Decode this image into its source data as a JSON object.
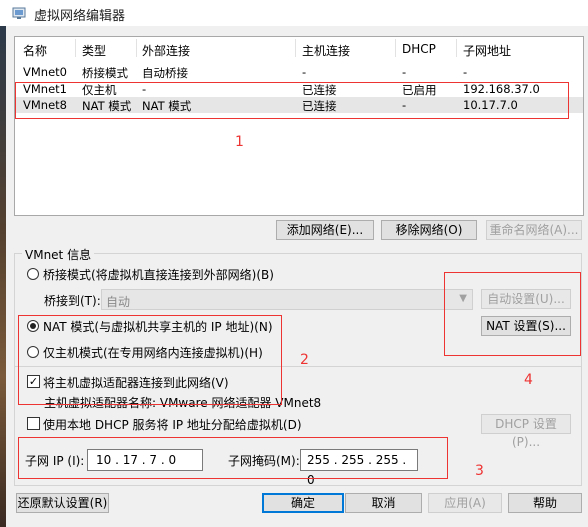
{
  "window": {
    "title": "虚拟网络编辑器"
  },
  "table": {
    "headers": [
      "名称",
      "类型",
      "外部连接",
      "主机连接",
      "DHCP",
      "子网地址"
    ],
    "rows": [
      {
        "name": "VMnet0",
        "type": "桥接模式",
        "external": "自动桥接",
        "host": "-",
        "dhcp": "-",
        "subnet": "-"
      },
      {
        "name": "VMnet1",
        "type": "仅主机",
        "external": "-",
        "host": "已连接",
        "dhcp": "已启用",
        "subnet": "192.168.37.0"
      },
      {
        "name": "VMnet8",
        "type": "NAT 模式",
        "external": "NAT 模式",
        "host": "已连接",
        "dhcp": "-",
        "subnet": "10.17.7.0"
      }
    ]
  },
  "list_buttons": {
    "add": "添加网络(E)...",
    "remove": "移除网络(O)",
    "rename": "重命名网络(A)..."
  },
  "vmnet_info": {
    "group_label": "VMnet 信息",
    "bridge_mode": "桥接模式(将虚拟机直接连接到外部网络)(B)",
    "bridge_to_label": "桥接到(T):",
    "bridge_to_value": "自动",
    "auto_settings": "自动设置(U)...",
    "nat_mode": "NAT 模式(与虚拟机共享主机的 IP 地址)(N)",
    "nat_settings": "NAT 设置(S)...",
    "host_only": "仅主机模式(在专用网络内连接虚拟机)(H)",
    "connect_adapter": "将主机虚拟适配器连接到此网络(V)",
    "adapter_name": "主机虚拟适配器名称: VMware 网络适配器 VMnet8",
    "use_dhcp": "使用本地 DHCP 服务将 IP 地址分配给虚拟机(D)",
    "dhcp_settings": "DHCP 设置(P)...",
    "subnet_ip_label": "子网 IP (I):",
    "subnet_ip": "10 . 17 . 7 . 0",
    "subnet_mask_label": "子网掩码(M):",
    "subnet_mask": "255 . 255 . 255 . 0"
  },
  "footer": {
    "restore": "还原默认设置(R)",
    "ok": "确定",
    "cancel": "取消",
    "apply": "应用(A)",
    "help": "帮助"
  },
  "annotations": [
    "1",
    "2",
    "3",
    "4"
  ],
  "colors": {
    "annotation": "#e33333",
    "default_button_border": "#0078d7"
  }
}
